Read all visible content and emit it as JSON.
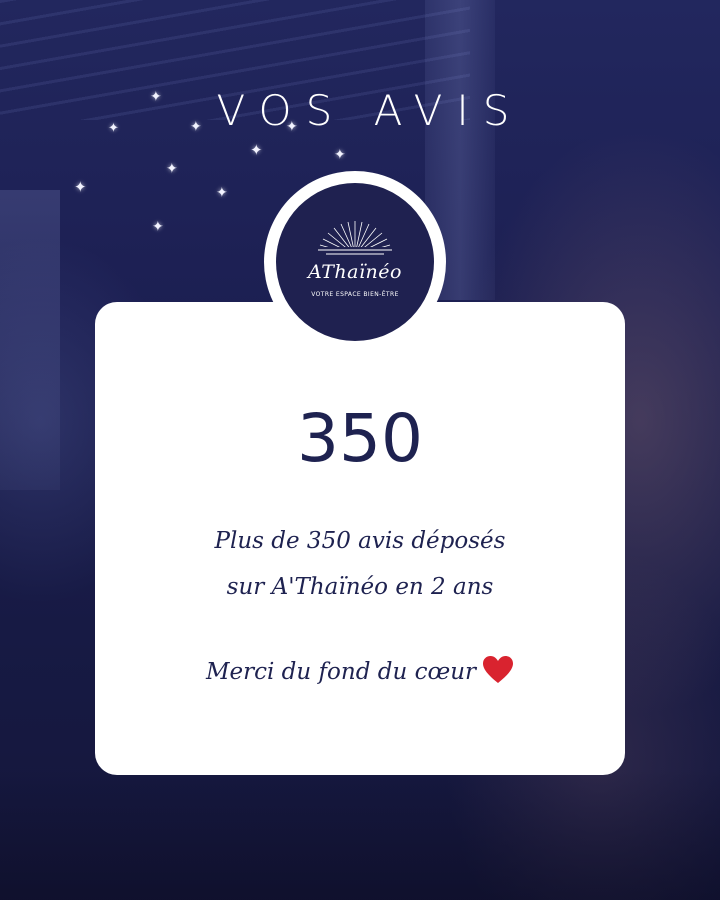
{
  "header": {
    "title": "VOS AVIS"
  },
  "logo": {
    "name": "AThaïnéo",
    "tagline": "VOTRE ESPACE BIEN-ÊTRE"
  },
  "card": {
    "number": "350",
    "line1": "Plus de 350 avis déposés",
    "line2": "sur A'Thaïnéo en 2 ans",
    "thanks": "Merci du fond du cœur"
  },
  "icons": {
    "heart": "heart-icon",
    "star": "sparkle-star-icon"
  },
  "colors": {
    "navy": "#1e2250",
    "background": "#1b1d4a",
    "heart": "#d9232f",
    "card": "#ffffff"
  }
}
